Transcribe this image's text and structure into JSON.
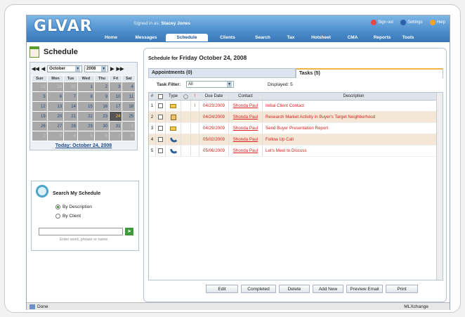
{
  "header": {
    "logo": "GLVAR",
    "signed_in_prefix": "Signed in as:",
    "signed_in_user": "Stacey Jones",
    "links": [
      {
        "label": "Sign out",
        "color": "#e34848"
      },
      {
        "label": "Settings",
        "color": "#2b5fa8"
      },
      {
        "label": "Help",
        "color": "#f0a42a"
      }
    ],
    "nav": [
      "Home",
      "Messages",
      "Schedule",
      "Clients",
      "Search",
      "Tax",
      "Hotsheet",
      "CMA",
      "Reports",
      "Tools"
    ],
    "nav_active": "Schedule"
  },
  "left": {
    "title": "Schedule",
    "calendar": {
      "month": "October",
      "year": "2008",
      "weekdays": [
        "Sun",
        "Mon",
        "Tue",
        "Wed",
        "Thu",
        "Fri",
        "Sat"
      ],
      "weeks": [
        [
          {
            "d": "28",
            "out": true
          },
          {
            "d": "29",
            "out": true
          },
          {
            "d": "30",
            "out": true
          },
          {
            "d": "1"
          },
          {
            "d": "2"
          },
          {
            "d": "3"
          },
          {
            "d": "4"
          }
        ],
        [
          {
            "d": "5"
          },
          {
            "d": "6"
          },
          {
            "d": "7"
          },
          {
            "d": "8"
          },
          {
            "d": "9"
          },
          {
            "d": "10"
          },
          {
            "d": "11"
          }
        ],
        [
          {
            "d": "12"
          },
          {
            "d": "13"
          },
          {
            "d": "14"
          },
          {
            "d": "15"
          },
          {
            "d": "16"
          },
          {
            "d": "17"
          },
          {
            "d": "18"
          }
        ],
        [
          {
            "d": "19"
          },
          {
            "d": "20"
          },
          {
            "d": "21"
          },
          {
            "d": "22"
          },
          {
            "d": "23"
          },
          {
            "d": "24",
            "today": true
          },
          {
            "d": "25"
          }
        ],
        [
          {
            "d": "26"
          },
          {
            "d": "27"
          },
          {
            "d": "28"
          },
          {
            "d": "29"
          },
          {
            "d": "30"
          },
          {
            "d": "31"
          },
          {
            "d": "1",
            "out": true
          }
        ],
        [
          {
            "d": "2",
            "out": true
          },
          {
            "d": "3",
            "out": true
          },
          {
            "d": "4",
            "out": true
          },
          {
            "d": "5",
            "out": true
          },
          {
            "d": "6",
            "out": true
          },
          {
            "d": "7",
            "out": true
          },
          {
            "d": "8",
            "out": true
          }
        ]
      ],
      "today_link": "Today: October 24, 2008"
    },
    "search": {
      "title": "Search My Schedule",
      "option_desc": "By Description",
      "option_client": "By Client",
      "selected": "By Description",
      "input_value": "",
      "hint": "Enter word, phrase or name."
    }
  },
  "main": {
    "heading_prefix": "Schedule for",
    "heading_date": "Friday October 24, 2008",
    "tab_appointments": "Appointments (0)",
    "tab_tasks": "Tasks (5)",
    "task_filter_label": "Task Filter:",
    "task_filter_value": "All",
    "displayed": "Displayed: 5",
    "columns": [
      "#",
      "",
      "Type",
      "",
      "!",
      "Due Date",
      "Contact",
      "Description"
    ],
    "rows": [
      {
        "n": "1",
        "type": "envelope",
        "pri": "!",
        "due": "04/23/2009",
        "contact": "Shonda Paul",
        "desc": "Initial Client Contact"
      },
      {
        "n": "2",
        "type": "house",
        "pri": "",
        "due": "04/24/2009",
        "contact": "Shonda Paul",
        "desc": "Research Market Activity in Buyer's Target Neighborhood"
      },
      {
        "n": "3",
        "type": "envelope",
        "pri": "",
        "due": "04/29/2009",
        "contact": "Shonda Paul",
        "desc": "Send Buyer Presentation Report"
      },
      {
        "n": "4",
        "type": "phone",
        "pri": "",
        "due": "05/02/2009",
        "contact": "Shonda Paul",
        "desc": "Follow Up Call"
      },
      {
        "n": "5",
        "type": "phone",
        "pri": "",
        "due": "05/06/2009",
        "contact": "Shonda Paul",
        "desc": "Let's Meet to Discuss"
      }
    ],
    "buttons": [
      "Edit",
      "Completed",
      "Delete",
      "Add New",
      "Preview Email",
      "Print"
    ]
  },
  "status": {
    "left": "Done",
    "zone": "MLXchange"
  }
}
